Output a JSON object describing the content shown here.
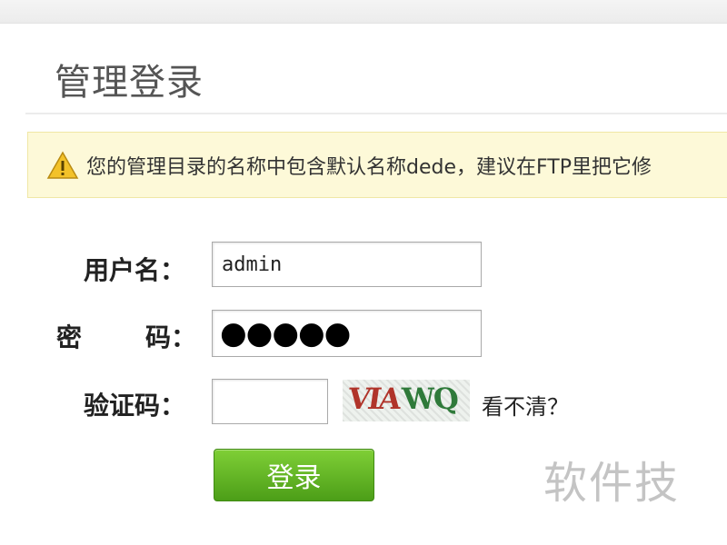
{
  "page": {
    "title": "管理登录"
  },
  "notice": {
    "icon": "warning-icon",
    "text": "您的管理目录的名称中包含默认名称dede，建议在FTP里把它修"
  },
  "form": {
    "username_label": "用户名：",
    "username_value": "admin",
    "password_label_part1": "密",
    "password_label_part2": "码：",
    "password_mask": "●●●●●",
    "captcha_label": "验证码：",
    "captcha_value": "",
    "captcha_text_part1": "VIA",
    "captcha_text_part2": "WQ",
    "refresh_link": "看不清？",
    "login_button": "登录"
  },
  "watermark": {
    "text": "软件技"
  },
  "colors": {
    "notice_bg": "#fdf9d8",
    "button_green": "#5cb123"
  }
}
